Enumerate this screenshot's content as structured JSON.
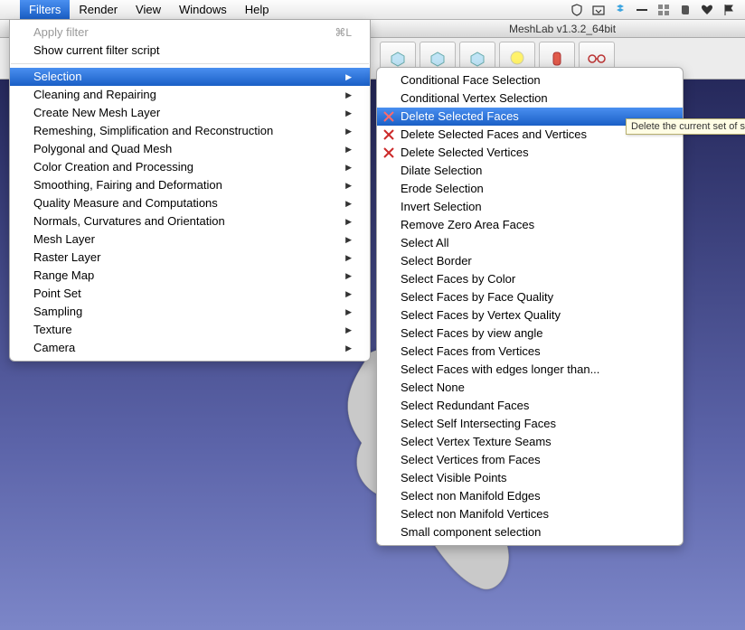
{
  "menubar": {
    "items": [
      "Filters",
      "Render",
      "View",
      "Windows",
      "Help"
    ],
    "active_index": 0
  },
  "status_icons": [
    "shield-icon",
    "tray-icon",
    "dropbox-icon",
    "dash-icon",
    "grid-icon",
    "evernote-icon",
    "heart-icon",
    "flag-icon"
  ],
  "window": {
    "title": "MeshLab v1.3.2_64bit"
  },
  "toolbar": {
    "buttons": [
      "cube-icon",
      "cube-icon",
      "cube-icon",
      "bulb-icon",
      "cylinder-icon",
      "barbell-icon"
    ]
  },
  "filters_menu": {
    "apply": "Apply filter",
    "apply_shortcut": "⌘L",
    "show_script": "Show current filter script",
    "items": [
      {
        "label": "Selection",
        "highlight": true
      },
      {
        "label": "Cleaning and Repairing"
      },
      {
        "label": "Create New Mesh Layer"
      },
      {
        "label": "Remeshing, Simplification and Reconstruction"
      },
      {
        "label": "Polygonal and Quad Mesh"
      },
      {
        "label": "Color Creation and Processing"
      },
      {
        "label": "Smoothing, Fairing and Deformation"
      },
      {
        "label": "Quality Measure and Computations"
      },
      {
        "label": "Normals, Curvatures and Orientation"
      },
      {
        "label": "Mesh Layer"
      },
      {
        "label": "Raster Layer"
      },
      {
        "label": "Range Map"
      },
      {
        "label": "Point Set"
      },
      {
        "label": "Sampling"
      },
      {
        "label": "Texture"
      },
      {
        "label": "Camera"
      }
    ]
  },
  "selection_menu": {
    "items": [
      {
        "label": "Conditional Face Selection"
      },
      {
        "label": "Conditional Vertex Selection"
      },
      {
        "label": "Delete Selected Faces",
        "highlight": true,
        "icon": "delete-face-icon"
      },
      {
        "label": "Delete Selected Faces and Vertices",
        "icon": "delete-face-vert-icon"
      },
      {
        "label": "Delete Selected Vertices",
        "icon": "delete-vert-icon"
      },
      {
        "label": "Dilate Selection"
      },
      {
        "label": "Erode Selection"
      },
      {
        "label": "Invert Selection"
      },
      {
        "label": "Remove Zero Area Faces"
      },
      {
        "label": "Select All"
      },
      {
        "label": "Select Border"
      },
      {
        "label": "Select Faces by Color"
      },
      {
        "label": "Select Faces by Face Quality"
      },
      {
        "label": "Select Faces by Vertex Quality"
      },
      {
        "label": "Select Faces by view angle"
      },
      {
        "label": "Select Faces from Vertices"
      },
      {
        "label": "Select Faces with edges longer than..."
      },
      {
        "label": "Select None"
      },
      {
        "label": "Select Redundant Faces"
      },
      {
        "label": "Select Self Intersecting Faces"
      },
      {
        "label": "Select Vertex Texture Seams"
      },
      {
        "label": "Select Vertices from Faces"
      },
      {
        "label": "Select Visible Points"
      },
      {
        "label": "Select non Manifold Edges"
      },
      {
        "label": "Select non Manifold Vertices"
      },
      {
        "label": "Small component selection"
      }
    ]
  },
  "tooltip": "Delete the current set of selected faces, vertices that remai"
}
